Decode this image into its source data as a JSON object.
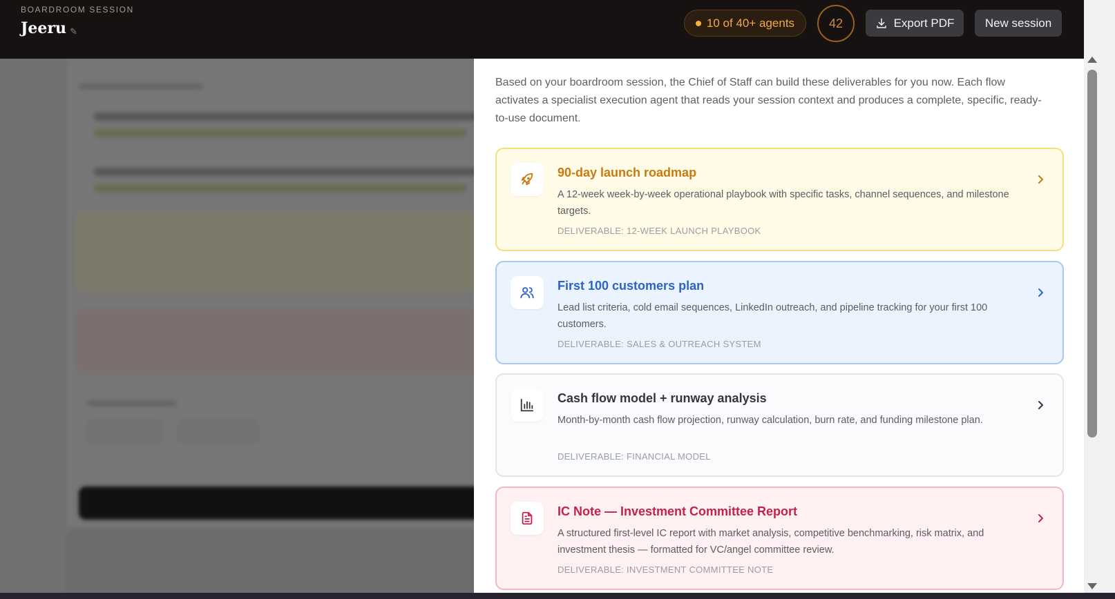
{
  "header": {
    "eyebrow": "BOARDROOM SESSION",
    "brand": "Jeeru",
    "agents_pill": "10 of 40+ agents",
    "score": "42",
    "export_label": "Export PDF",
    "new_session_label": "New session"
  },
  "panel": {
    "intro": "Based on your boardroom session, the Chief of Staff can build these deliverables for you now. Each flow activates a specialist execution agent that reads your session context and produces a complete, specific, ready-to-use document.",
    "cards": [
      {
        "title": "90-day launch roadmap",
        "description": "A 12-week week-by-week operational playbook with specific tasks, channel sequences, and milestone targets.",
        "deliverable": "DELIVERABLE: 12-WEEK LAUNCH PLAYBOOK",
        "icon": "rocket-icon",
        "accent": "#c77a12"
      },
      {
        "title": "First 100 customers plan",
        "description": "Lead list criteria, cold email sequences, LinkedIn outreach, and pipeline tracking for your first 100 customers.",
        "deliverable": "DELIVERABLE: SALES & OUTREACH SYSTEM",
        "icon": "users-icon",
        "accent": "#2b63c6"
      },
      {
        "title": "Cash flow model + runway analysis",
        "description": "Month-by-month cash flow projection, runway calculation, burn rate, and funding milestone plan.",
        "deliverable": "DELIVERABLE: FINANCIAL MODEL",
        "icon": "bar-chart-icon",
        "accent": "#34363c"
      },
      {
        "title": "IC Note — Investment Committee Report",
        "description": "A structured first-level IC report with market analysis, competitive benchmarking, risk matrix, and investment thesis — formatted for VC/angel committee review.",
        "deliverable": "DELIVERABLE: INVESTMENT COMMITTEE NOTE",
        "icon": "document-icon",
        "accent": "#c2234b"
      }
    ]
  }
}
